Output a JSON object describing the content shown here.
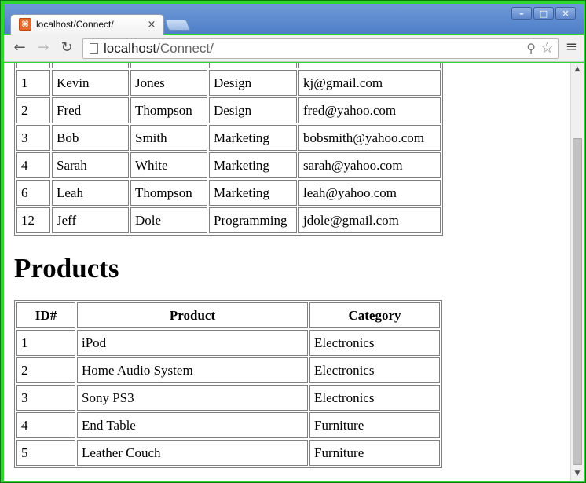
{
  "browser": {
    "tab_title": "localhost/Connect/",
    "favicon_glyph": "⌘",
    "tab_close": "×",
    "window_buttons": {
      "minimize": "–",
      "maximize": "□",
      "close": "✕"
    },
    "nav": {
      "back": "←",
      "forward": "→",
      "reload": "↻",
      "menu": "≡"
    },
    "url_host": "localhost",
    "url_path": "/Connect/",
    "zoom_icon": "⚲",
    "star_icon": "☆"
  },
  "employees": {
    "rows": [
      [
        "1",
        "Kevin",
        "Jones",
        "Design",
        "kj@gmail.com"
      ],
      [
        "2",
        "Fred",
        "Thompson",
        "Design",
        "fred@yahoo.com"
      ],
      [
        "3",
        "Bob",
        "Smith",
        "Marketing",
        "bobsmith@yahoo.com"
      ],
      [
        "4",
        "Sarah",
        "White",
        "Marketing",
        "sarah@yahoo.com"
      ],
      [
        "6",
        "Leah",
        "Thompson",
        "Marketing",
        "leah@yahoo.com"
      ],
      [
        "12",
        "Jeff",
        "Dole",
        "Programming",
        "jdole@gmail.com"
      ]
    ]
  },
  "products": {
    "heading": "Products",
    "headers": [
      "ID#",
      "Product",
      "Category"
    ],
    "rows": [
      [
        "1",
        "iPod",
        "Electronics"
      ],
      [
        "2",
        "Home Audio System",
        "Electronics"
      ],
      [
        "3",
        "Sony PS3",
        "Electronics"
      ],
      [
        "4",
        "End Table",
        "Furniture"
      ],
      [
        "5",
        "Leather Couch",
        "Furniture"
      ]
    ]
  },
  "scrollbar": {
    "up": "▲",
    "down": "▼",
    "scroll_position": 0.18
  }
}
